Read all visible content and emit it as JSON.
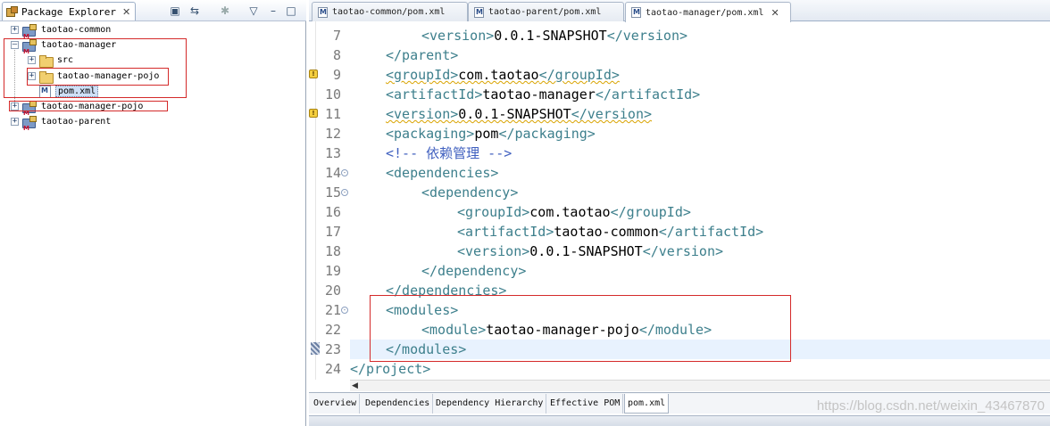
{
  "explorer": {
    "tab_label": "Package Explorer",
    "close_glyph": "✕",
    "toolbar": [
      "▣",
      "⇆",
      "✱",
      "▽",
      "–",
      "□"
    ],
    "items": [
      {
        "label": "taotao-common",
        "type": "project",
        "expander": "+"
      },
      {
        "label": "taotao-manager",
        "type": "project",
        "expander": "–"
      },
      {
        "label": "src",
        "type": "folder",
        "expander": "+"
      },
      {
        "label": "taotao-manager-pojo",
        "type": "folder",
        "expander": "+"
      },
      {
        "label": "pom.xml",
        "type": "xml",
        "expander": ""
      },
      {
        "label": "taotao-manager-pojo",
        "type": "project",
        "expander": "+"
      },
      {
        "label": "taotao-parent",
        "type": "project",
        "expander": "+"
      }
    ]
  },
  "editor": {
    "tabs": [
      {
        "label": "taotao-common/pom.xml",
        "active": false
      },
      {
        "label": "taotao-parent/pom.xml",
        "active": false
      },
      {
        "label": "taotao-manager/pom.xml",
        "active": true
      }
    ],
    "tab_close_glyph": "✕",
    "line_numbers": [
      "7",
      "8",
      "9",
      "10",
      "11",
      "12",
      "13",
      "14",
      "15",
      "16",
      "17",
      "18",
      "19",
      "20",
      "21",
      "22",
      "23",
      "24"
    ],
    "lines": {
      "l7": {
        "open": "<version>",
        "text": "0.0.1-SNAPSHOT",
        "close": "</version>"
      },
      "l8": {
        "tag": "</parent>"
      },
      "l9": {
        "open": "<groupId>",
        "text": "com.taotao",
        "close": "</groupId>"
      },
      "l10": {
        "open": "<artifactId>",
        "text": "taotao-manager",
        "close": "</artifactId>"
      },
      "l11": {
        "open": "<version>",
        "text": "0.0.1-SNAPSHOT",
        "close": "</version>"
      },
      "l12": {
        "open": "<packaging>",
        "text": "pom",
        "close": "</packaging>"
      },
      "l13": {
        "comment": "<!-- 依赖管理 -->"
      },
      "l14": {
        "tag": "<dependencies>"
      },
      "l15": {
        "tag": "<dependency>"
      },
      "l16": {
        "open": "<groupId>",
        "text": "com.taotao",
        "close": "</groupId>"
      },
      "l17": {
        "open": "<artifactId>",
        "text": "taotao-common",
        "close": "</artifactId>"
      },
      "l18": {
        "open": "<version>",
        "text": "0.0.1-SNAPSHOT",
        "close": "</version>"
      },
      "l19": {
        "tag": "</dependency>"
      },
      "l20": {
        "tag": "</dependencies>"
      },
      "l21": {
        "tag": "<modules>"
      },
      "l22": {
        "open": "<module>",
        "text": "taotao-manager-pojo",
        "close": "</module>"
      },
      "l23": {
        "tag": "</modules>"
      },
      "l24": {
        "tag": "</project>"
      }
    },
    "bottom_tabs": [
      "Overview",
      "Dependencies",
      "Dependency Hierarchy",
      "Effective POM",
      "pom.xml"
    ],
    "active_bottom_tab": "pom.xml",
    "scroll_arrow": "◀"
  },
  "watermark": "https://blog.csdn.net/weixin_43467870",
  "colors": {
    "tag": "#3d7f8c",
    "comment": "#3f5fbf",
    "highlight_box": "#d42a2a",
    "current_line": "#e8f2fe"
  }
}
